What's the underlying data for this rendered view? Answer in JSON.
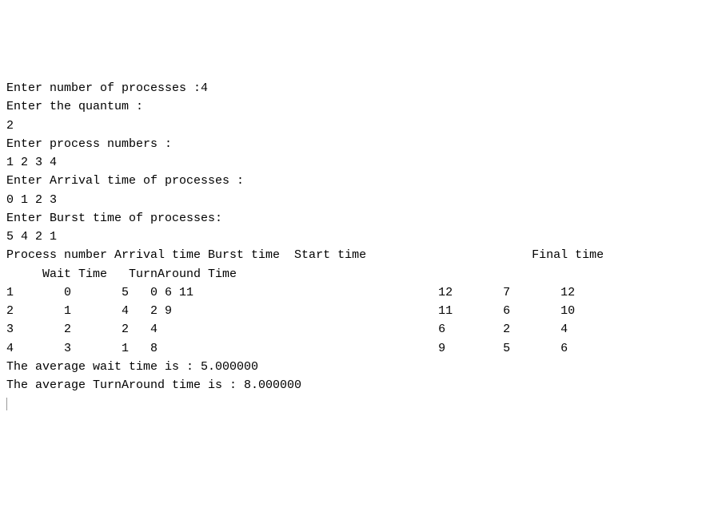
{
  "terminal": {
    "lines": [
      "Enter number of processes :4",
      "Enter the quantum :",
      "2",
      "Enter process numbers :",
      "1 2 3 4",
      "Enter Arrival time of processes :",
      "0 1 2 3",
      "Enter Burst time of processes:",
      "5 4 2 1",
      "Process number Arrival time Burst time  Start time                       Final time",
      "     Wait Time   TurnAround Time",
      "1       0       5   0 6 11                                  12       7       12",
      "2       1       4   2 9                                     11       6       10",
      "3       2       2   4                                       6        2       4",
      "4       3       1   8                                       9        5       6",
      "The average wait time is : 5.000000",
      "The average TurnAround time is : 8.000000"
    ],
    "avg_wait_time": "5.000000",
    "avg_turnaround_time": "8.000000",
    "num_processes": "4",
    "quantum": "2",
    "process_numbers": "1 2 3 4",
    "arrival_times": "0 1 2 3",
    "burst_times": "5 4 2 1"
  }
}
